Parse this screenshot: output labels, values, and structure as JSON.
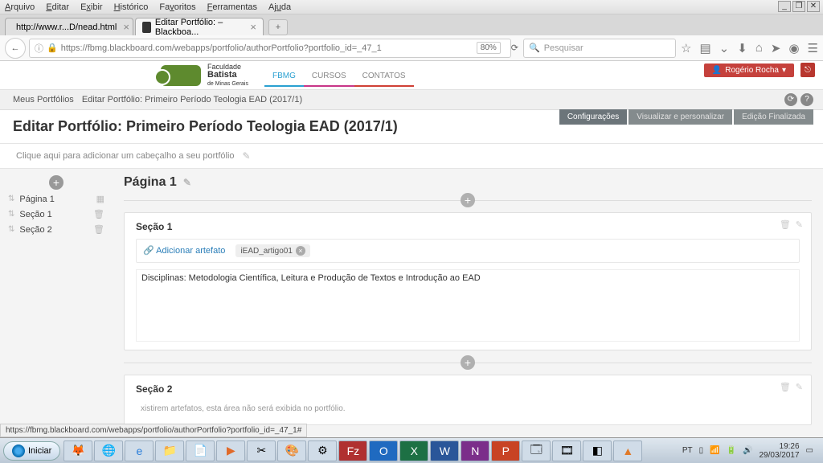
{
  "browser": {
    "menu": {
      "arquivo": "Arquivo",
      "editar": "Editar",
      "exibir": "Exibir",
      "historico": "Histórico",
      "favoritos": "Favoritos",
      "ferramentas": "Ferramentas",
      "ajuda": "Ajuda"
    },
    "tabs": [
      {
        "title": "http://www.r...D/nead.html"
      },
      {
        "title": "Editar Portfólio: – Blackboa..."
      }
    ],
    "url": "https://fbmg.blackboard.com/webapps/portfolio/authorPortfolio?portfolio_id=_47_1",
    "zoom": "80%",
    "search_placeholder": "Pesquisar",
    "status_link": "https://fbmg.blackboard.com/webapps/portfolio/authorPortfolio?portfolio_id=_47_1#"
  },
  "site": {
    "brand_line1": "Faculdade",
    "brand_line2": "Batista",
    "brand_line3": "de Minas Gerais",
    "nav": {
      "fbmg": "FBMG",
      "cursos": "CURSOS",
      "contatos": "CONTATOS"
    },
    "user": "Rogério Rocha"
  },
  "breadcrumb": {
    "root": "Meus Portfólios",
    "current": "Editar Portfólio: Primeiro Período Teologia EAD (2017/1)"
  },
  "page": {
    "title": "Editar Portfólio: Primeiro Período Teologia EAD (2017/1)",
    "actions": {
      "config": "Configurações",
      "preview": "Visualizar e personalizar",
      "final": "Edição Finalizada"
    },
    "header_hint": "Clique aqui para adicionar um cabeçalho a seu portfólio"
  },
  "sidebar": {
    "items": [
      {
        "label": "Página 1",
        "type": "page"
      },
      {
        "label": "Seção 1",
        "type": "section"
      },
      {
        "label": "Seção 2",
        "type": "section"
      }
    ]
  },
  "content": {
    "page_heading": "Página 1",
    "sec1": {
      "title": "Seção 1",
      "add_artifact": "Adicionar artefato",
      "artifact_chip": "iEAD_artigo01",
      "body": "Disciplinas: Metodologia Científica, Leitura e Produção de Textos e Introdução ao EAD"
    },
    "sec2": {
      "title": "Seção 2",
      "hint": "xistirem artefatos, esta área não será exibida no portfólio."
    }
  },
  "taskbar": {
    "start": "Iniciar",
    "lang": "PT",
    "time": "19:26",
    "date": "29/03/2017"
  }
}
